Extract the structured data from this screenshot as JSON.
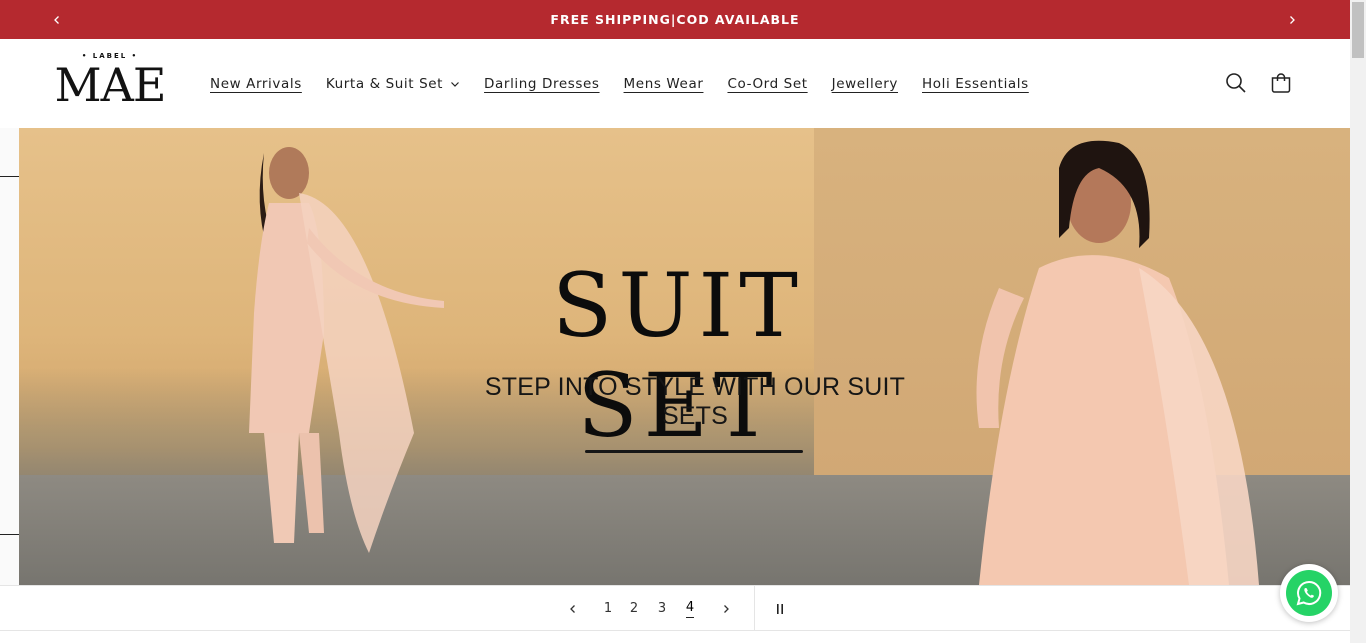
{
  "announcement": {
    "text": "FREE SHIPPING|COD AVAILABLE",
    "prev_icon": "chevron-left-icon",
    "next_icon": "chevron-right-icon",
    "background": "#b5292f"
  },
  "logo": {
    "small_text": "• LABEL •",
    "main_text": "MAE"
  },
  "nav": {
    "items": [
      {
        "label": "New Arrivals"
      },
      {
        "label": "Kurta & Suit Set"
      },
      {
        "label": "Darling Dresses"
      },
      {
        "label": "Mens Wear"
      },
      {
        "label": "Co-Ord Set"
      },
      {
        "label": "Jewellery"
      },
      {
        "label": "Holi Essentials"
      }
    ]
  },
  "header_icons": [
    "search-icon",
    "cart-icon"
  ],
  "hero": {
    "headline": "SUIT SET",
    "subline": "STEP INTO STYLE WITH OUR SUIT SETS"
  },
  "slider": {
    "slides": [
      "1",
      "2",
      "3",
      "4"
    ],
    "current": "4",
    "prev_icon": "chevron-left-icon",
    "next_icon": "chevron-right-icon",
    "pause_icon": "pause-icon"
  },
  "floating": {
    "icon": "whatsapp-icon",
    "color": "#25d366"
  }
}
